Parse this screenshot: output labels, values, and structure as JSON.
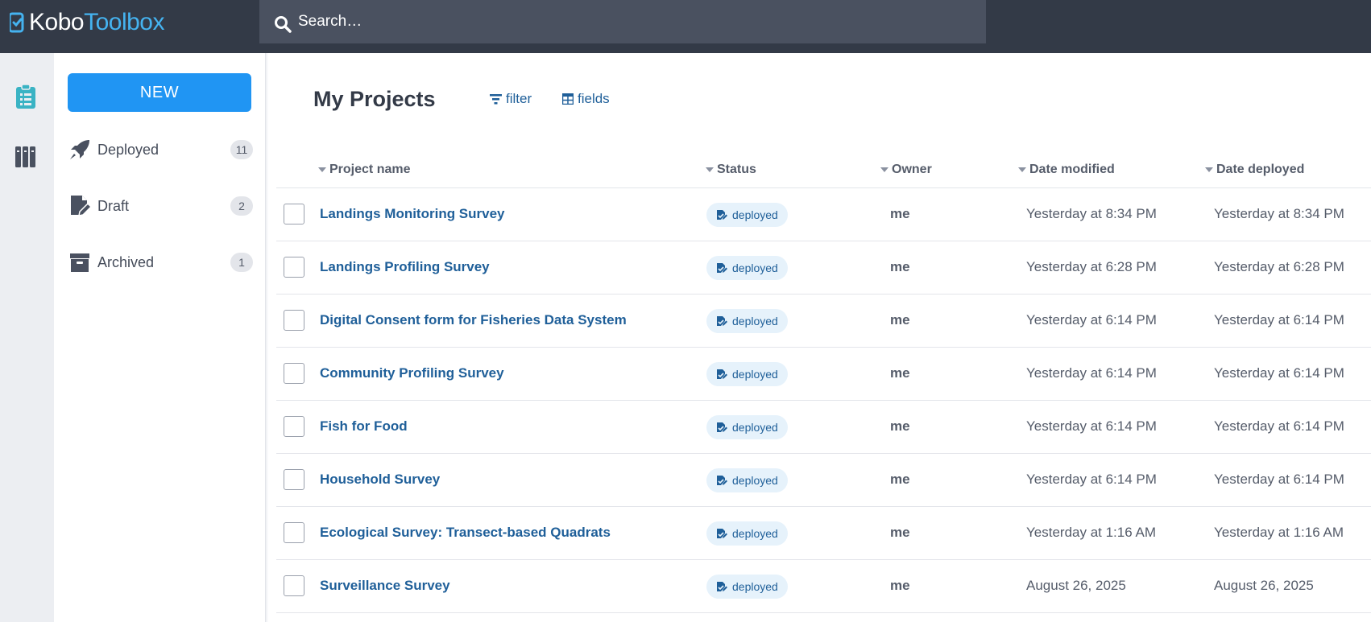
{
  "brand": {
    "kobo": "Kobo",
    "toolbox": "Toolbox",
    "accent": "#45b3f0",
    "topbar_bg": "#333a47"
  },
  "search": {
    "placeholder": "Search…"
  },
  "rail": {
    "icons": [
      "projects-icon",
      "library-icon"
    ]
  },
  "sidebar": {
    "new_label": "NEW",
    "items": [
      {
        "label": "Deployed",
        "count": "11",
        "icon": "rocket-icon"
      },
      {
        "label": "Draft",
        "count": "2",
        "icon": "draft-icon"
      },
      {
        "label": "Archived",
        "count": "1",
        "icon": "archive-icon"
      }
    ]
  },
  "main": {
    "title": "My Projects",
    "filter_label": "filter",
    "fields_label": "fields",
    "columns": [
      "Project name",
      "Status",
      "Owner",
      "Date modified",
      "Date deployed"
    ],
    "rows": [
      {
        "name": "Landings Monitoring Survey",
        "status": "deployed",
        "owner": "me",
        "modified": "Yesterday at 8:34 PM",
        "deployed": "Yesterday at 8:34 PM"
      },
      {
        "name": "Landings Profiling Survey",
        "status": "deployed",
        "owner": "me",
        "modified": "Yesterday at 6:28 PM",
        "deployed": "Yesterday at 6:28 PM"
      },
      {
        "name": "Digital Consent form for Fisheries Data System",
        "status": "deployed",
        "owner": "me",
        "modified": "Yesterday at 6:14 PM",
        "deployed": "Yesterday at 6:14 PM"
      },
      {
        "name": "Community Profiling Survey",
        "status": "deployed",
        "owner": "me",
        "modified": "Yesterday at 6:14 PM",
        "deployed": "Yesterday at 6:14 PM"
      },
      {
        "name": "Fish for Food",
        "status": "deployed",
        "owner": "me",
        "modified": "Yesterday at 6:14 PM",
        "deployed": "Yesterday at 6:14 PM"
      },
      {
        "name": "Household Survey",
        "status": "deployed",
        "owner": "me",
        "modified": "Yesterday at 6:14 PM",
        "deployed": "Yesterday at 6:14 PM"
      },
      {
        "name": "Ecological Survey: Transect-based Quadrats",
        "status": "deployed",
        "owner": "me",
        "modified": "Yesterday at 1:16 AM",
        "deployed": "Yesterday at 1:16 AM"
      },
      {
        "name": "Surveillance Survey",
        "status": "deployed",
        "owner": "me",
        "modified": "August 26, 2025",
        "deployed": "August 26, 2025"
      }
    ]
  }
}
